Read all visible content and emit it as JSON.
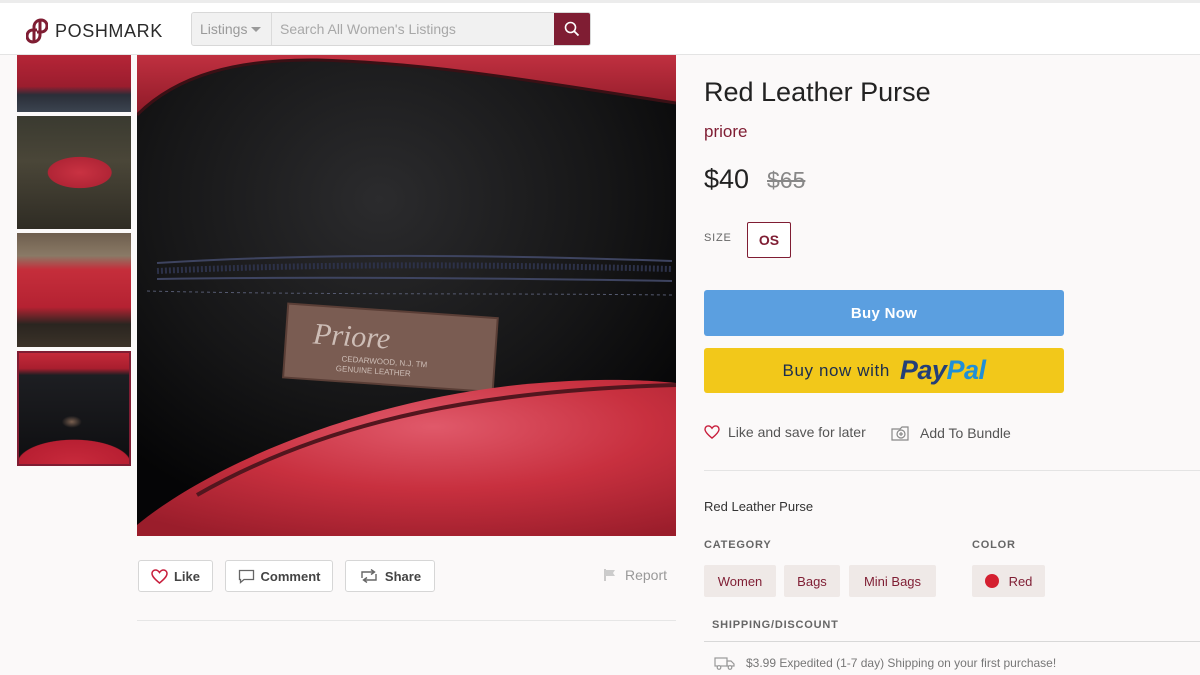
{
  "header": {
    "logo_text": "POSHMARK",
    "search_scope": "Listings",
    "search_placeholder": "Search All Women's Listings",
    "accent_color": "#7f1d33"
  },
  "gallery": {
    "thumbnails": [
      "thumb-1",
      "thumb-2",
      "thumb-3",
      "thumb-4"
    ],
    "selected_index": 3
  },
  "actions": {
    "like_label": "Like",
    "comment_label": "Comment",
    "share_label": "Share",
    "report_label": "Report"
  },
  "listing": {
    "title": "Red Leather Purse",
    "brand": "priore",
    "price": "$40",
    "original_price": "$65",
    "size_label": "SIZE",
    "size_value": "OS",
    "buy_now_label": "Buy Now",
    "paypal_prefix": "Buy now with",
    "paypal_pay": "Pay",
    "paypal_pal": "Pal",
    "like_save_label": "Like and save for later",
    "bundle_label": "Add To Bundle",
    "description": "Red Leather Purse",
    "category_label": "CATEGORY",
    "categories": [
      "Women",
      "Bags",
      "Mini Bags"
    ],
    "color_label": "COLOR",
    "color_value": "Red",
    "color_swatch": "#d42030",
    "shipping_label": "SHIPPING/DISCOUNT",
    "shipping_text": "$3.99 Expedited (1-7 day) Shipping on your first purchase!"
  },
  "colors": {
    "buy_now_bg": "#5b9fe0",
    "paypal_bg": "#f2c81a"
  }
}
